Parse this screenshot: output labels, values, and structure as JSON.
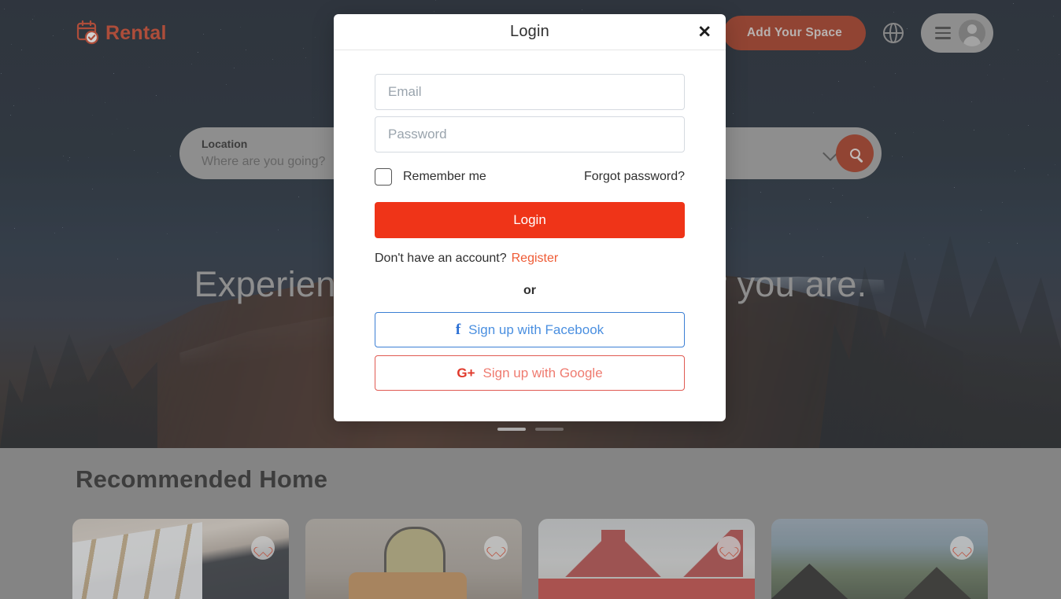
{
  "header": {
    "logo_text": "Rental",
    "logo_icon": "calendar-check-icon",
    "add_space_label": "Add Your Space",
    "globe_icon": "globe-icon",
    "menu_icon": "hamburger-icon",
    "avatar_icon": "user-avatar-icon",
    "accent_color": "#9e2a10",
    "logo_color": "#c8381a"
  },
  "search": {
    "location_label": "Location",
    "location_placeholder": "Where are you going?",
    "chevron_icon": "chevron-down-icon",
    "search_icon": "search-icon"
  },
  "hero": {
    "headline": "Experiences that match wherever you are.",
    "dots": [
      {
        "active": true
      },
      {
        "active": false
      }
    ]
  },
  "section": {
    "title": "Recommended Home",
    "cards": [
      {
        "name": "attic-bedroom-card",
        "favorite_icon": "heart-icon"
      },
      {
        "name": "living-room-card",
        "favorite_icon": "heart-icon"
      },
      {
        "name": "red-roof-house-card",
        "favorite_icon": "heart-icon"
      },
      {
        "name": "mountain-cabin-card",
        "favorite_icon": "heart-icon"
      }
    ]
  },
  "modal": {
    "title": "Login",
    "close_label": "✕",
    "email_value": "",
    "email_placeholder": "Email",
    "password_value": "",
    "password_placeholder": "Password",
    "remember_label": "Remember me",
    "remember_checked": false,
    "forgot_label": "Forgot password?",
    "login_label": "Login",
    "login_button_color": "#ef3418",
    "register_prompt": "Don't have an account?",
    "register_label": "Register",
    "register_color": "#ef5b35",
    "or_label": "or",
    "facebook_label": "Sign up with Facebook",
    "facebook_glyph": "f",
    "facebook_color": "#3b7fd4",
    "google_label": "Sign up with Google",
    "google_glyph": "G+",
    "google_color": "#e05a52"
  }
}
